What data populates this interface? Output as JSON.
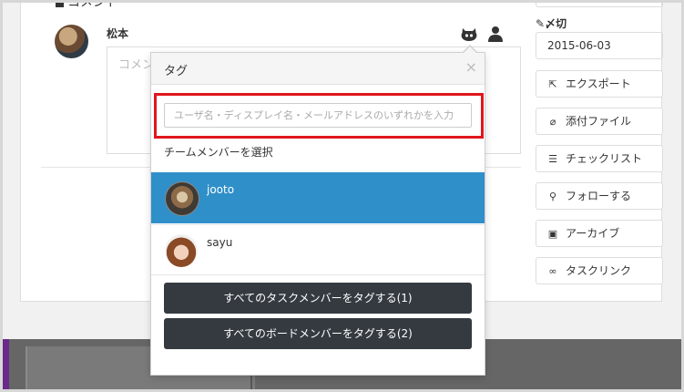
{
  "comment": {
    "heading": "コメント",
    "user_name": "松本",
    "textarea_placeholder": "コメントを"
  },
  "sidebar": {
    "due_label": "〆切",
    "due_date": "2015-06-03",
    "buttons": [
      {
        "label": "エクスポート",
        "icon": "export-icon"
      },
      {
        "label": "添付ファイル",
        "icon": "paperclip-icon"
      },
      {
        "label": "チェックリスト",
        "icon": "list-icon"
      },
      {
        "label": "フォローする",
        "icon": "follow-icon"
      },
      {
        "label": "アーカイブ",
        "icon": "archive-icon"
      },
      {
        "label": "タスクリンク",
        "icon": "link-icon"
      }
    ]
  },
  "popover": {
    "title": "タグ",
    "close": "×",
    "search_placeholder": "ユーザ名・ディスプレイ名・メールアドレスのいずれかを入力",
    "members_label": "チームメンバーを選択",
    "members": [
      {
        "name": "jooto",
        "selected": true
      },
      {
        "name": "sayu",
        "selected": false
      }
    ],
    "tag_all_task_members": "すべてのタスクメンバーをタグする(1)",
    "tag_all_board_members": "すべてのボードメンバーをタグする(2)"
  },
  "colors": {
    "selected_row": "#2f8fc9",
    "highlight_border": "#e0161b",
    "dark_button": "#343a40"
  }
}
